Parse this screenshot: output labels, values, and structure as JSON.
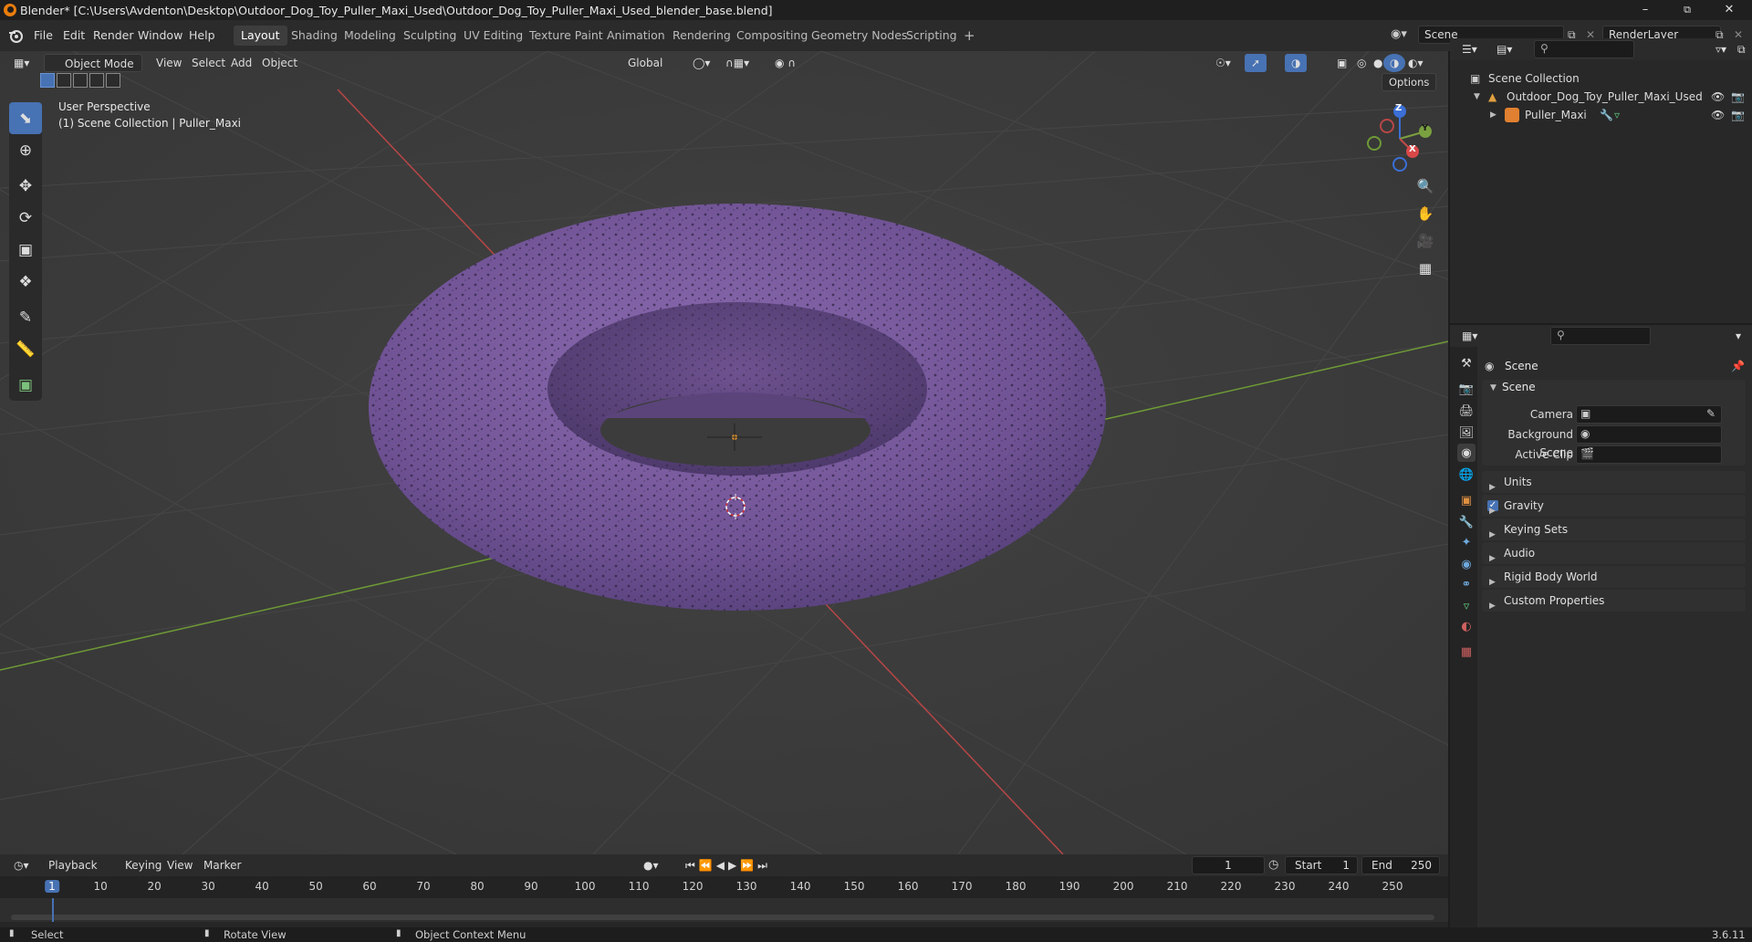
{
  "window": {
    "title": "Blender* [C:\\Users\\Avdenton\\Desktop\\Outdoor_Dog_Toy_Puller_Maxi_Used\\Outdoor_Dog_Toy_Puller_Maxi_Used_blender_base.blend]",
    "minimize": "–",
    "maximize": "⧉",
    "close": "✕"
  },
  "menu": [
    "File",
    "Edit",
    "Render",
    "Window",
    "Help"
  ],
  "workspaces": [
    "Layout",
    "Shading",
    "Modeling",
    "Sculpting",
    "UV Editing",
    "Texture Paint",
    "Animation",
    "Rendering",
    "Compositing",
    "Geometry Nodes",
    "Scripting"
  ],
  "workspace_add": "+",
  "scene_selector": "Scene",
  "renderlayer_selector": "RenderLayer",
  "viewport": {
    "mode": "Object Mode",
    "menus": [
      "View",
      "Select",
      "Add",
      "Object"
    ],
    "orientation": "Global",
    "options_label": "Options",
    "overlay_line1": "User Perspective",
    "overlay_line2": "(1) Scene Collection | Puller_Maxi",
    "gizmo": {
      "z": "Z",
      "y": "Y",
      "x": "X"
    },
    "object_color": "#7a5aa0",
    "grid_x_color": "#c24a4a",
    "grid_y_color": "#7aa040"
  },
  "outliner": {
    "root": "Scene Collection",
    "collection": "Outdoor_Dog_Toy_Puller_Maxi_Used",
    "object": "Puller_Maxi"
  },
  "properties": {
    "header": "Scene",
    "section": "Scene",
    "camera_label": "Camera",
    "background_label": "Background Scene",
    "clip_label": "Active Clip",
    "panels": [
      "Units",
      "Gravity",
      "Keying Sets",
      "Audio",
      "Rigid Body World",
      "Custom Properties"
    ],
    "gravity_checked": true
  },
  "timeline": {
    "menus": [
      "Playback",
      "Keying",
      "View",
      "Marker"
    ],
    "current_frame": "1",
    "start_label": "Start",
    "start": "1",
    "end_label": "End",
    "end": "250",
    "ticks": [
      "1",
      "10",
      "20",
      "30",
      "40",
      "50",
      "60",
      "70",
      "80",
      "90",
      "100",
      "110",
      "120",
      "130",
      "140",
      "150",
      "160",
      "170",
      "180",
      "190",
      "200",
      "210",
      "220",
      "230",
      "240",
      "250"
    ]
  },
  "status": {
    "select": "Select",
    "rotate": "Rotate View",
    "context": "Object Context Menu",
    "version": "3.6.11"
  }
}
